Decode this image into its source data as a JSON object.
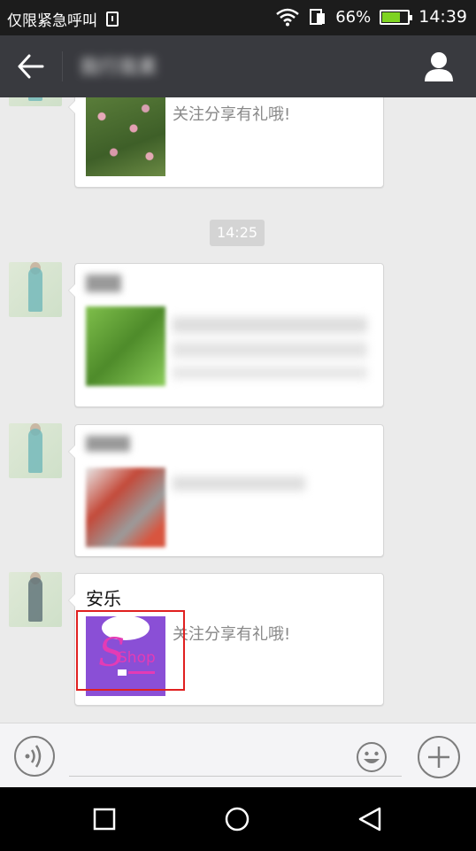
{
  "status_bar": {
    "carrier": "仅限紧急呼叫",
    "battery_percent": "66%",
    "battery_level": 0.66,
    "time": "14:39"
  },
  "header": {
    "title": "我行我素",
    "back_icon": "arrow-left-icon",
    "profile_icon": "person-icon"
  },
  "messages": [
    {
      "sender": "",
      "text": "关注分享有礼哦!",
      "thumb": "flowers"
    },
    {
      "sender": "",
      "text": "",
      "thumb": "green"
    },
    {
      "sender": "",
      "text": "",
      "thumb": "red"
    },
    {
      "sender": "安乐",
      "text": "关注分享有礼哦!",
      "thumb": "shop",
      "thumb_text": "Shop"
    }
  ],
  "timestamp": "14:25",
  "input_bar": {
    "placeholder": "",
    "voice_icon": "voice-icon",
    "emoji_icon": "smiley-icon",
    "plus_icon": "plus-icon"
  },
  "nav_bar": {
    "icons": [
      "recents-square-icon",
      "home-circle-icon",
      "back-triangle-icon"
    ]
  },
  "colors": {
    "header_bg": "#393a3f",
    "chat_bg": "#ebebeb",
    "highlight": "#e02020",
    "shop_purple": "#8a4fd6",
    "shop_pink": "#e43bb5"
  }
}
